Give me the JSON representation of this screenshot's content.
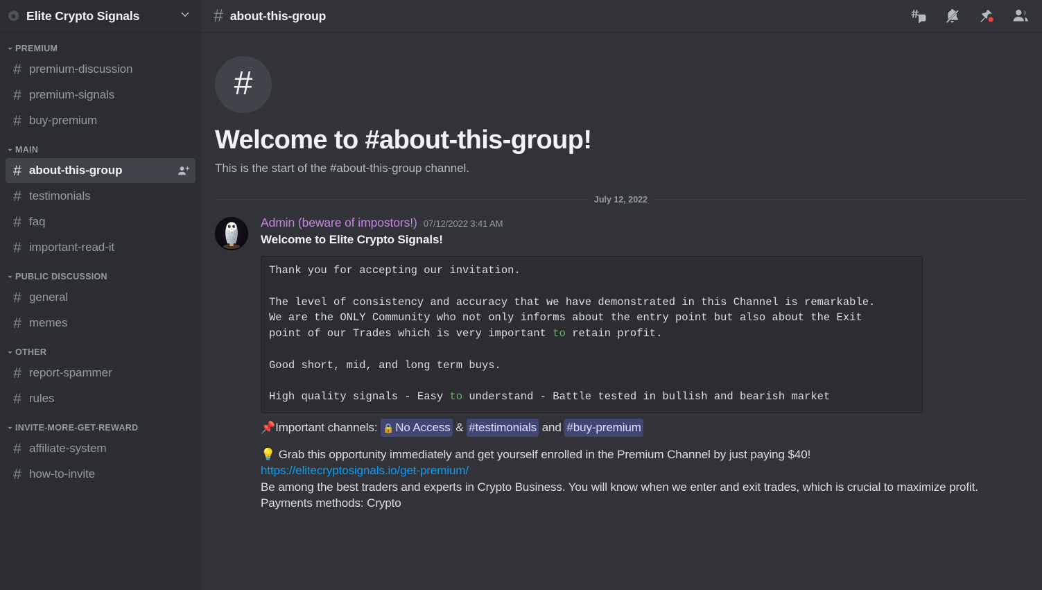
{
  "server": {
    "name": "Elite Crypto Signals",
    "icon": "server-gear-icon",
    "caret": "chevron-down-icon"
  },
  "sidebar": {
    "categories": [
      {
        "label": "PREMIUM",
        "channels": [
          {
            "name": "premium-discussion",
            "active": false
          },
          {
            "name": "premium-signals",
            "active": false
          },
          {
            "name": "buy-premium",
            "active": false
          }
        ]
      },
      {
        "label": "MAIN",
        "channels": [
          {
            "name": "about-this-group",
            "active": true,
            "action_icon": "person-add-icon"
          },
          {
            "name": "testimonials",
            "active": false
          },
          {
            "name": "faq",
            "active": false
          },
          {
            "name": "important-read-it",
            "active": false
          }
        ]
      },
      {
        "label": "PUBLIC DISCUSSION",
        "channels": [
          {
            "name": "general",
            "active": false
          },
          {
            "name": "memes",
            "active": false
          }
        ]
      },
      {
        "label": "OTHER",
        "channels": [
          {
            "name": "report-spammer",
            "active": false
          },
          {
            "name": "rules",
            "active": false
          }
        ]
      },
      {
        "label": "INVITE-MORE-GET-REWARD",
        "channels": [
          {
            "name": "affiliate-system",
            "active": false
          },
          {
            "name": "how-to-invite",
            "active": false
          }
        ]
      }
    ]
  },
  "channel_header": {
    "hash": "#",
    "title": "about-this-group",
    "actions": [
      {
        "icon": "threads-icon"
      },
      {
        "icon": "notifications-muted-icon"
      },
      {
        "icon": "pinned-messages-icon"
      },
      {
        "icon": "member-list-icon"
      }
    ]
  },
  "welcome": {
    "icon": "#",
    "title": "Welcome to #about-this-group!",
    "subtitle": "This is the start of the #about-this-group channel."
  },
  "date_divider": "July 12, 2022",
  "message": {
    "avatar": "snowy-owl-avatar",
    "author": "Admin (beware of impostors!)",
    "timestamp": "07/12/2022 3:41 AM",
    "heading": "Welcome to Elite Crypto Signals!",
    "code_lines": [
      "Thank you for accepting our invitation.",
      "",
      "The level of consistency and accuracy that we have demonstrated in this Channel is remarkable.",
      "We are the ONLY Community who not only informs about the entry point but also about the Exit",
      "point of our Trades which is very important to retain profit.",
      "",
      "Good short, mid, and long term buys.",
      "",
      "High quality signals - Easy to understand - Battle tested in bullish and bearish market"
    ],
    "code_highlight_keyword": "to",
    "pin_emoji": "📌",
    "important_prefix": "Important channels:",
    "mention_no_access": "No Access",
    "sep_amp": "&",
    "mention_testimonials": "#testimonials",
    "sep_and": "and",
    "mention_buy_premium": "#buy-premium",
    "bulb_emoji": "💡",
    "offer_text": "Grab this opportunity immediately and get yourself enrolled in the Premium Channel by just paying $40!",
    "link": "https://elitecryptosignals.io/get-premium/",
    "closing_text": "Be among the best traders and experts in Crypto Business. You will know when we enter and exit trades, which is crucial to maximize profit.",
    "payments_text": "Payments methods: Crypto"
  },
  "colors": {
    "sidebar_bg": "#2b2d31",
    "main_bg": "#313338",
    "accent_author": "#c586e0",
    "mention_bg": "#414675",
    "link": "#0a9cf5",
    "code_keyword": "#6aab73",
    "active_channel_bg": "#3f4248"
  }
}
